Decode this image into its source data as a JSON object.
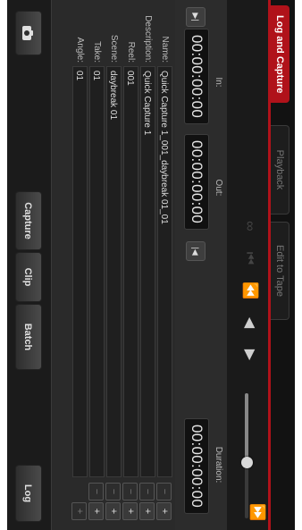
{
  "tabs": [
    {
      "label": "Log and Capture",
      "active": true
    },
    {
      "label": "Playback",
      "active": false
    },
    {
      "label": "Edit to Tape",
      "active": false
    }
  ],
  "transport": {
    "icons": [
      "loop-icon",
      "prev-edit-icon",
      "rewind-icon",
      "play-reverse-icon",
      "play-icon",
      "fast-forward-icon",
      "next-edit-icon"
    ],
    "shuttle_level": 0.55
  },
  "timecode": {
    "in_label": "In:",
    "in_value": "00:00:00:00",
    "out_label": "Out:",
    "out_value": "00:00:00:00",
    "duration_label": "Duration:",
    "duration_value": "00:00:00:00"
  },
  "fields": [
    {
      "label": "Name:",
      "value": "Quick Capture 1_001_daybreak 01_01"
    },
    {
      "label": "Description:",
      "value": "Quick Capture 1"
    },
    {
      "label": "Reel:",
      "value": "001"
    },
    {
      "label": "Scene:",
      "value": "daybreak 01"
    },
    {
      "label": "Take:",
      "value": "01"
    },
    {
      "label": "Angle:",
      "value": "01"
    }
  ],
  "bottom": {
    "capture": "Capture",
    "clip": "Clip",
    "batch": "Batch",
    "log": "Log"
  },
  "colors": {
    "accent": "#b0121a"
  }
}
